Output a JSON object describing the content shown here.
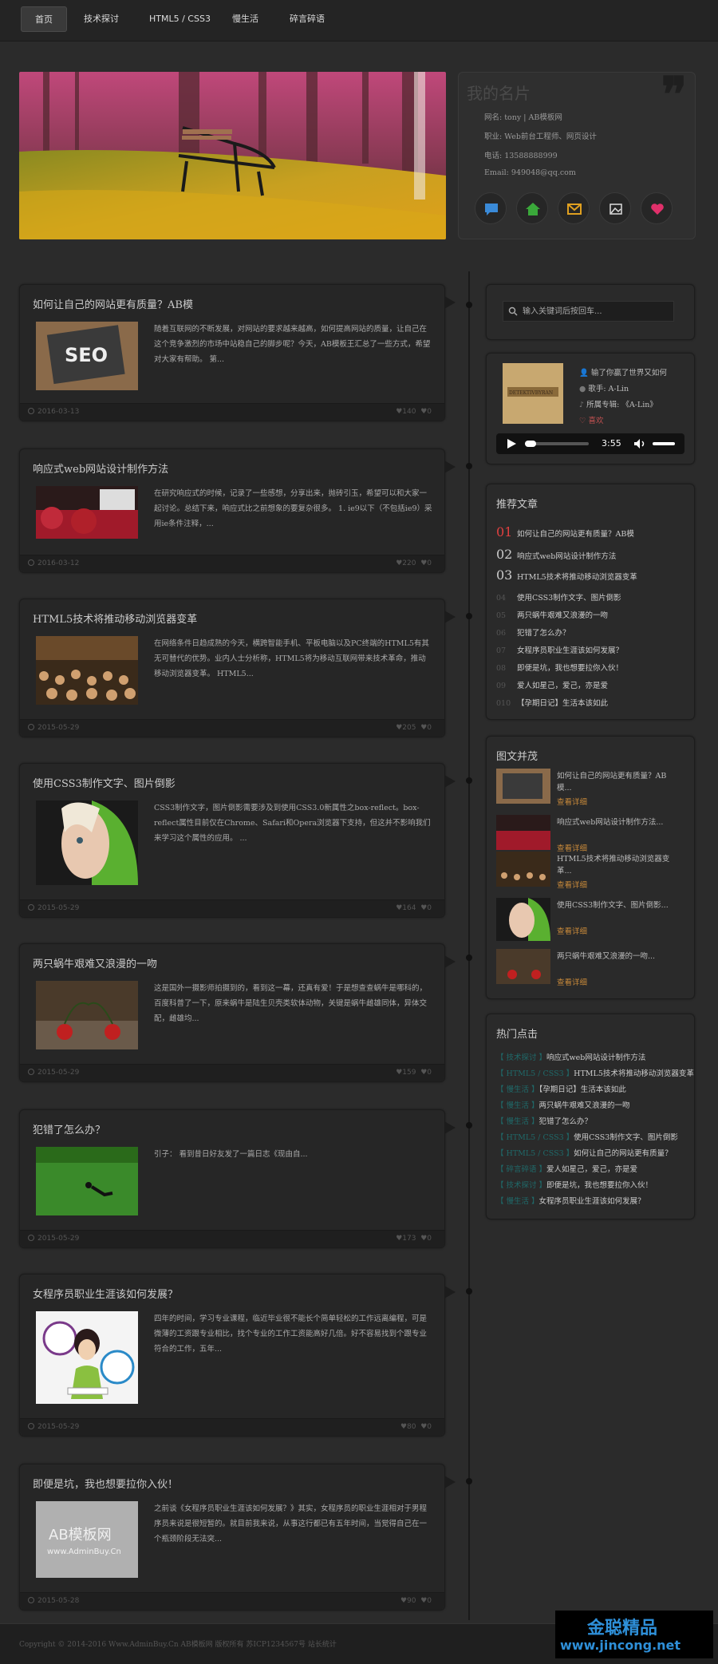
{
  "nav": {
    "items": [
      "首页",
      "技术探讨",
      "HTML5 / CSS3",
      "慢生活",
      "碎言碎语"
    ]
  },
  "profile": {
    "title": "我的名片",
    "name": "网名: tony | AB模板网",
    "job": "职业: Web前台工程师、网页设计",
    "phone": "电话: 13588888999",
    "email": "Email: 949048@qq.com"
  },
  "posts": [
    {
      "title": "如何让自己的网站更有质量？AB模",
      "excerpt": "随着互联网的不断发展，对网站的要求越来越高，如何提高网站的质量，让自己在这个竞争激烈的市场中站稳自己的脚步呢？今天，AB模板王汇总了一些方式，希望对大家有帮助。 第...",
      "date": "2016-03-13",
      "comments": "140",
      "likes": "0"
    },
    {
      "title": "响应式web网站设计制作方法",
      "excerpt": "在研究响应式的时候，记录了一些感想，分享出来，抛砖引玉，希望可以和大家一起讨论。总结下来，响应式比之前想象的要复杂很多。 1. ie9以下（不包括ie9）采用ie条件注释，...",
      "date": "2016-03-12",
      "comments": "220",
      "likes": "0"
    },
    {
      "title": "HTML5技术将推动移动浏览器变革",
      "excerpt": "在网络条件日趋成熟的今天，横跨智能手机、平板电脑以及PC终端的HTML5有其无可替代的优势。业内人士分析称，HTML5将为移动互联网带来技术革命，推动移动浏览器变革。 HTML5...",
      "date": "2015-05-29",
      "comments": "205",
      "likes": "0"
    },
    {
      "title": "使用CSS3制作文字、图片倒影",
      "excerpt": "CSS3制作文字，图片倒影需要涉及到使用CSS3.0新属性之box-reflect。box-reflect属性目前仅在Chrome、Safari和Opera浏览器下支持，但这并不影响我们来学习这个属性的应用。 ...",
      "date": "2015-05-29",
      "comments": "164",
      "likes": "0"
    },
    {
      "title": "两只蜗牛艰难又浪漫的一吻",
      "excerpt": "这是国外一摄影师拍摄到的，看到这一幕，还真有爱！于是想查查蜗牛是哪科的，百度科普了一下，原来蜗牛是陆生贝壳类软体动物，关键是蜗牛雌雄同体，异体交配，雌雄均...",
      "date": "2015-05-29",
      "comments": "159",
      "likes": "0"
    },
    {
      "title": "犯错了怎么办？",
      "excerpt": "引子： 看到昔日好友发了一篇日志《现由自...",
      "date": "2015-05-29",
      "comments": "173",
      "likes": "0"
    },
    {
      "title": "女程序员职业生涯该如何发展？",
      "excerpt": "四年的时间，学习专业课程，临近毕业很不能长个简单轻松的工作远离编程，可是微薄的工资跟专业相比，找个专业的工作工资能高好几倍。好不容易找到个跟专业符合的工作，五年...",
      "date": "2015-05-29",
      "comments": "80",
      "likes": "0"
    },
    {
      "title": "即便是坑，我也想要拉你入伙！",
      "excerpt": "之前谈《女程序员职业生涯该如何发展？》其实，女程序员的职业生涯相对于男程序员来说是很短暂的。就目前我来说，从事这行都已有五年时间，当觉得自己在一个瓶颈阶段无法突...",
      "date": "2015-05-28",
      "comments": "90",
      "likes": "0"
    }
  ],
  "thumb_text": {
    "seo": "SEO",
    "ab": "AB模板网",
    "ab_url": "www.AdminBuy.Cn"
  },
  "search": {
    "placeholder": "输入关键词后按回车..."
  },
  "music": {
    "cover_text": "DETEKTIVBYRAN",
    "song": "输了你赢了世界又如何",
    "artist": "歌手: A-Lin",
    "album": "所属专辑: 《A-Lin》",
    "fav": "喜欢",
    "time": "3:55"
  },
  "recommend": {
    "title": "推荐文章",
    "items": [
      {
        "num": "01",
        "text": "如何让自己的网站更有质量？AB模"
      },
      {
        "num": "02",
        "text": "响应式web网站设计制作方法"
      },
      {
        "num": "03",
        "text": "HTML5技术将推动移动浏览器变革"
      },
      {
        "num": "04",
        "text": "使用CSS3制作文字、图片倒影"
      },
      {
        "num": "05",
        "text": "两只蜗牛艰难又浪漫的一吻"
      },
      {
        "num": "06",
        "text": "犯错了怎么办？"
      },
      {
        "num": "07",
        "text": "女程序员职业生涯该如何发展？"
      },
      {
        "num": "08",
        "text": "即便是坑，我也想要拉你入伙！"
      },
      {
        "num": "09",
        "text": "爱人如星己，爱己，亦是爱"
      },
      {
        "num": "010",
        "text": "【孕期日记】生活本该如此"
      }
    ]
  },
  "pictext": {
    "title": "图文并茂",
    "more": "查看详细",
    "items": [
      {
        "text": "如何让自己的网站更有质量？AB模..."
      },
      {
        "text": "响应式web网站设计制作方法..."
      },
      {
        "text": "HTML5技术将推动移动浏览器变革..."
      },
      {
        "text": "使用CSS3制作文字、图片倒影..."
      },
      {
        "text": "两只蜗牛艰难又浪漫的一吻..."
      }
    ]
  },
  "hot": {
    "title": "热门点击",
    "items": [
      {
        "tag": "【 技术探讨 】",
        "text": "响应式web网站设计制作方法"
      },
      {
        "tag": "【 HTML5 / CSS3 】",
        "text": "HTML5技术将推动移动浏览器变革"
      },
      {
        "tag": "【 慢生活 】",
        "text": "【孕期日记】生活本该如此"
      },
      {
        "tag": "【 慢生活 】",
        "text": "两只蜗牛艰难又浪漫的一吻"
      },
      {
        "tag": "【 慢生活 】",
        "text": "犯错了怎么办？"
      },
      {
        "tag": "【 HTML5 / CSS3 】",
        "text": "使用CSS3制作文字、图片倒影"
      },
      {
        "tag": "【 HTML5 / CSS3 】",
        "text": "如何让自己的网站更有质量？"
      },
      {
        "tag": "【 碎言碎语 】",
        "text": "爱人如星己，爱己，亦是爱"
      },
      {
        "tag": "【 技术探讨 】",
        "text": "即便是坑，我也想要拉你入伙！"
      },
      {
        "tag": "【 慢生活 】",
        "text": "女程序员职业生涯该如何发展？"
      }
    ]
  },
  "footer": {
    "copyright": "Copyright © 2014-2016 Www.AdminBuy.Cn AB模板网 版权所有 苏ICP1234567号 站长统计"
  },
  "watermark": {
    "line1": "金聪精品",
    "line2": "www.jincong.net"
  }
}
